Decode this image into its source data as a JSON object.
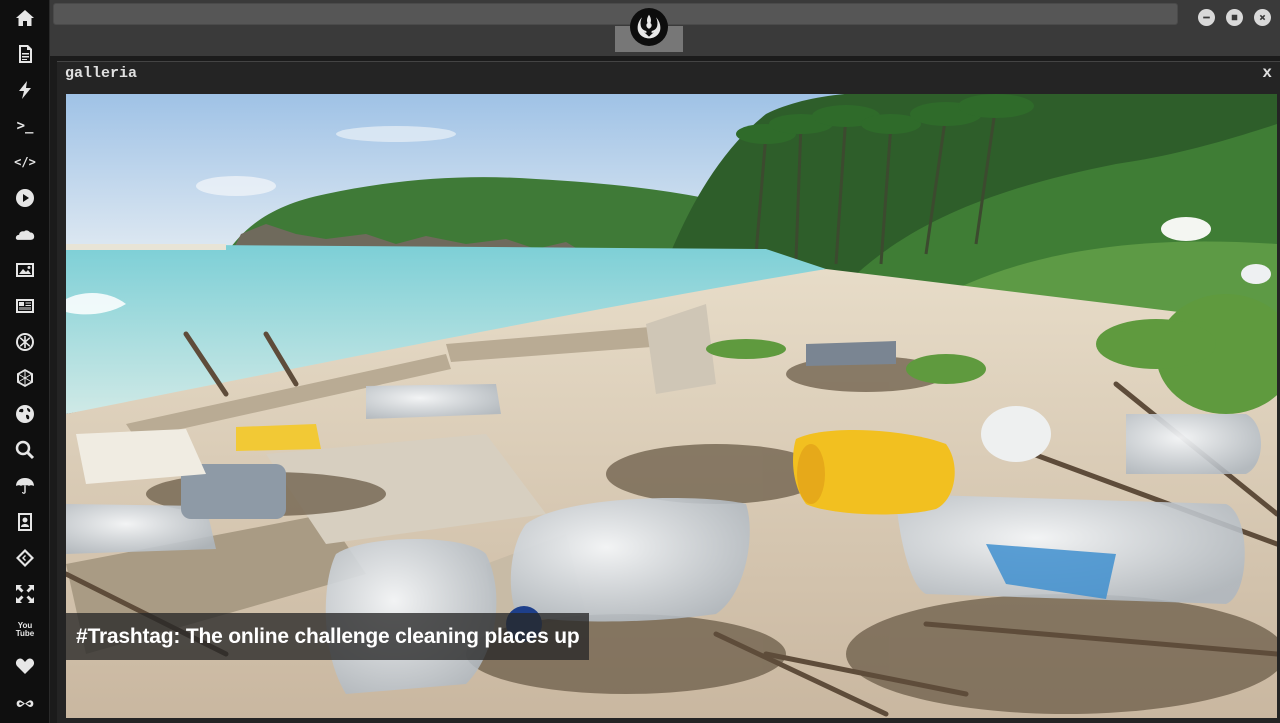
{
  "sidebar": {
    "items": [
      {
        "name": "home-icon"
      },
      {
        "name": "document-icon"
      },
      {
        "name": "lightning-icon"
      },
      {
        "name": "terminal-icon",
        "glyph": ">_"
      },
      {
        "name": "code-icon",
        "glyph": "</>"
      },
      {
        "name": "play-icon"
      },
      {
        "name": "cloud-icon"
      },
      {
        "name": "image-icon"
      },
      {
        "name": "newspaper-icon"
      },
      {
        "name": "asterisk-icon"
      },
      {
        "name": "hexagon-icon"
      },
      {
        "name": "globe-icon"
      },
      {
        "name": "search-icon"
      },
      {
        "name": "umbrella-icon"
      },
      {
        "name": "contacts-icon"
      },
      {
        "name": "diamond-code-icon"
      },
      {
        "name": "expand-icon"
      },
      {
        "name": "youtube-icon",
        "glyph": "You Tube"
      },
      {
        "name": "heart-icon"
      },
      {
        "name": "infinity-cloud-icon"
      }
    ]
  },
  "window": {
    "minimize": "–",
    "maximize": "■",
    "close": "×"
  },
  "panel": {
    "title": "galleria",
    "close_label": "x",
    "caption": "#Trashtag: The online challenge cleaning places up"
  },
  "colors": {
    "sidebar_bg": "#0f0f0f",
    "topbar_bg": "#3a3a3a",
    "panel_bg": "#242424",
    "caption_bg": "#282828"
  }
}
